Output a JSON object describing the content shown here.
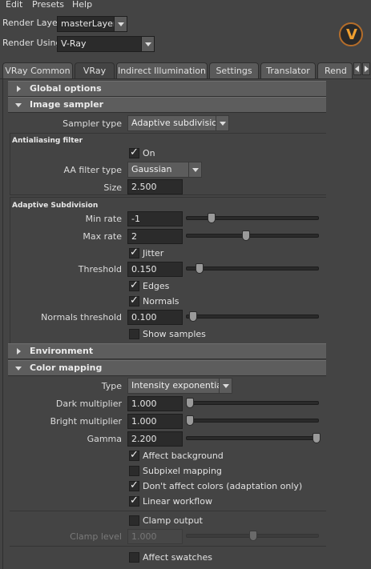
{
  "menu": [
    "Edit",
    "Presets",
    "Help"
  ],
  "render_layer": {
    "label": "Render Layer",
    "value": "masterLayer"
  },
  "render_using": {
    "label": "Render Using",
    "value": "V-Ray"
  },
  "tabs": [
    "VRay Common",
    "VRay",
    "Indirect Illumination",
    "Settings",
    "Translator",
    "Rend"
  ],
  "sections": {
    "global_options": "Global options",
    "image_sampler": "Image sampler",
    "environment": "Environment",
    "color_mapping": "Color mapping"
  },
  "image_sampler": {
    "sampler_type_label": "Sampler type",
    "sampler_type_value": "Adaptive subdivision",
    "aa_heading": "Antialiasing filter",
    "on_label": "On",
    "aa_filter_label": "AA filter type",
    "aa_filter_value": "Gaussian",
    "size_label": "Size",
    "size_value": "2.500",
    "adaptive_heading": "Adaptive Subdivision",
    "min_rate_label": "Min rate",
    "min_rate_value": "-1",
    "max_rate_label": "Max rate",
    "max_rate_value": "2",
    "jitter_label": "Jitter",
    "threshold_label": "Threshold",
    "threshold_value": "0.150",
    "edges_label": "Edges",
    "normals_label": "Normals",
    "normals_threshold_label": "Normals threshold",
    "normals_threshold_value": "0.100",
    "show_samples_label": "Show samples"
  },
  "color_mapping": {
    "type_label": "Type",
    "type_value": "Intensity exponential",
    "dark_label": "Dark multiplier",
    "dark_value": "1.000",
    "bright_label": "Bright multiplier",
    "bright_value": "1.000",
    "gamma_label": "Gamma",
    "gamma_value": "2.200",
    "affect_background": "Affect background",
    "subpixel_mapping": "Subpixel mapping",
    "dont_affect_colors": "Don't affect colors (adaptation only)",
    "linear_workflow": "Linear workflow",
    "clamp_output": "Clamp output",
    "clamp_level_label": "Clamp level",
    "clamp_level_value": "1.000",
    "affect_swatches": "Affect swatches"
  }
}
